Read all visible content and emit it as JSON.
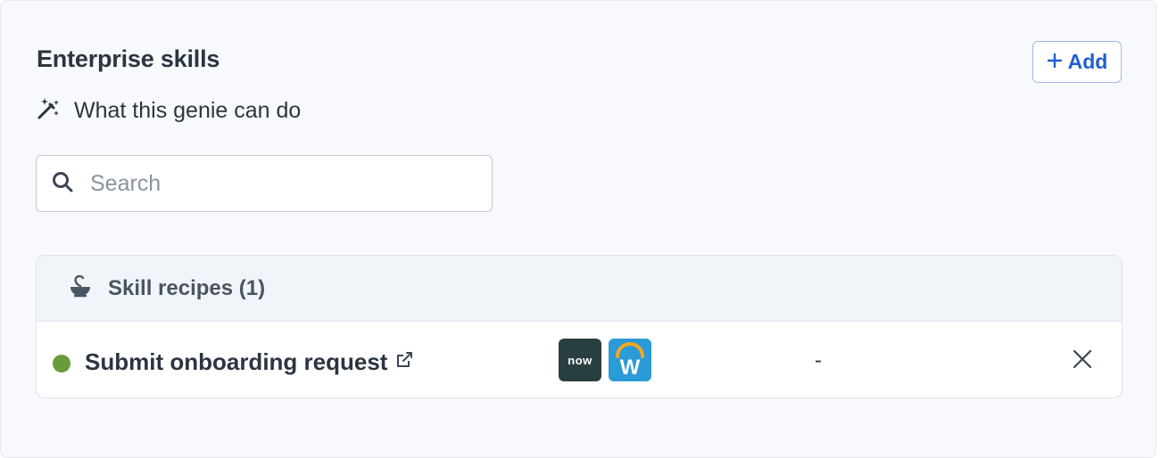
{
  "section": {
    "title": "Enterprise skills",
    "subtitle": "What this genie can do",
    "subtitle_icon": "magic-wand-icon",
    "add_button": {
      "icon": "plus-icon",
      "label": "Add"
    }
  },
  "search": {
    "placeholder": "Search",
    "value": "",
    "icon": "search-icon"
  },
  "skill_recipes": {
    "header_label": "Skill recipes (1)",
    "header_icon": "bowl-spoon-icon",
    "rows": [
      {
        "name": "Submit onboarding request",
        "status_color": "#6a9b3a",
        "link_icon": "external-link-icon",
        "apps": [
          {
            "name": "servicenow-logo",
            "text": "now",
            "bg": "#293e40"
          },
          {
            "name": "workday-logo",
            "text": "W",
            "bg": "#2a9bd6",
            "arc": "#f5a623"
          }
        ],
        "extra": "-",
        "remove_icon": "close-icon"
      }
    ]
  },
  "colors": {
    "accent": "#1f5fd1",
    "panel_bg": "#f8f9fc",
    "status_active": "#6a9b3a"
  }
}
